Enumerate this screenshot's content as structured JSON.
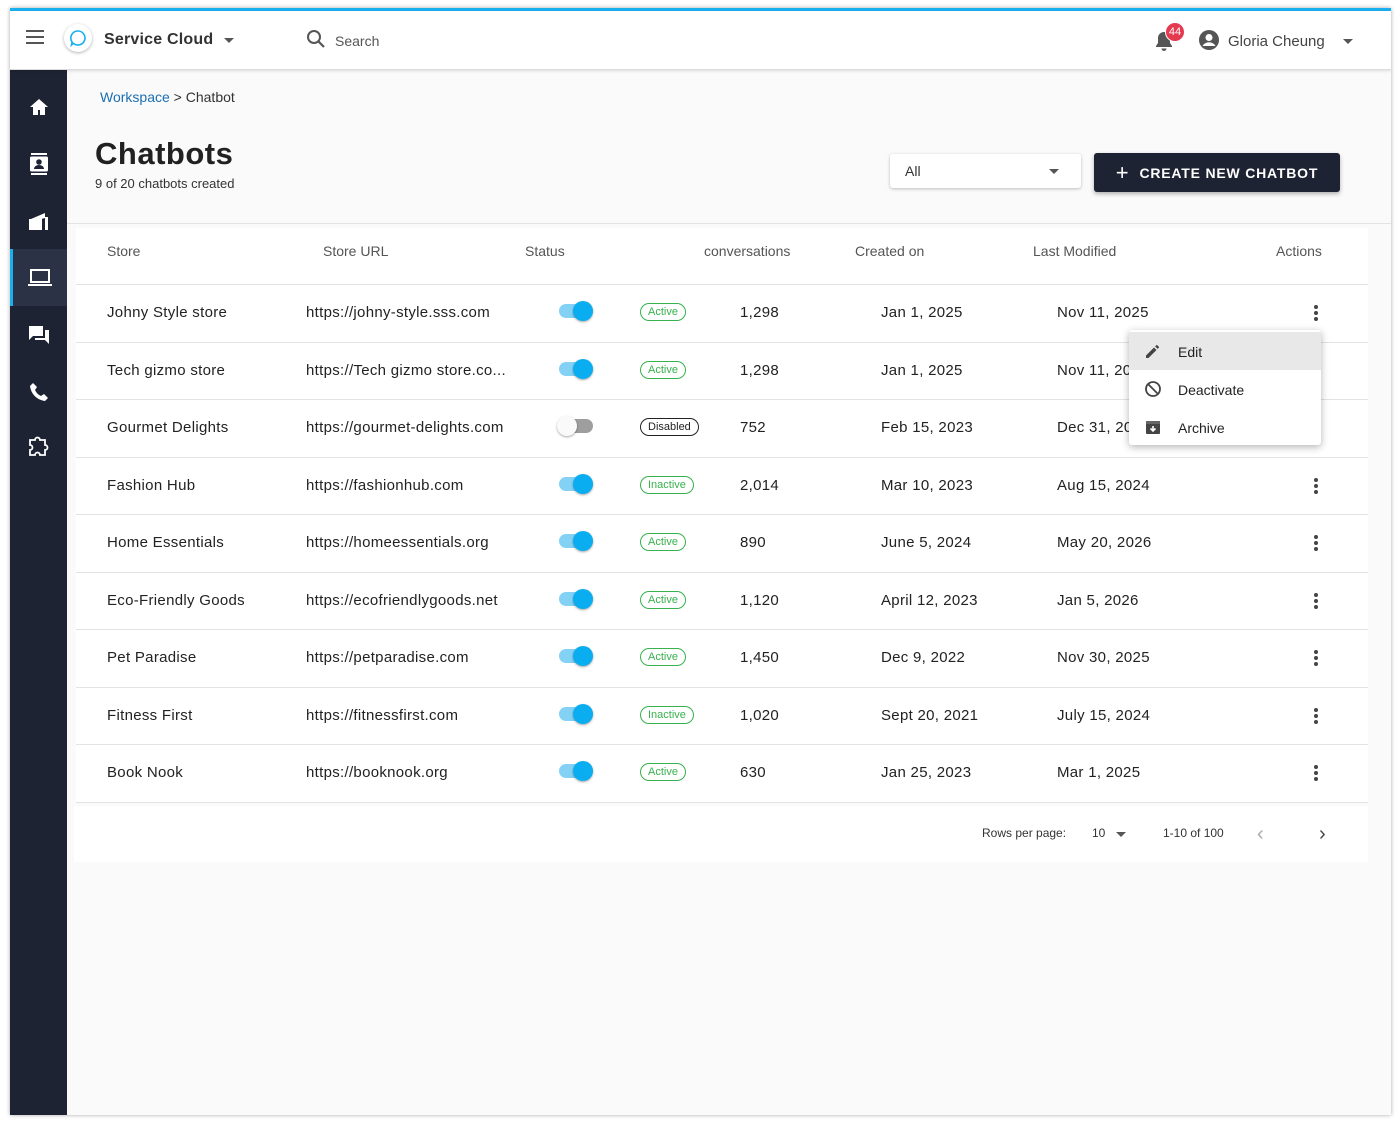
{
  "app": {
    "title": "Service Cloud",
    "search_label": "Search",
    "notification_count": "44",
    "user_name": "Gloria Cheung",
    "accent_color": "#1ab0ef"
  },
  "sidebar": {
    "items": [
      {
        "name": "home-icon"
      },
      {
        "name": "contacts-icon"
      },
      {
        "name": "campaign-icon"
      },
      {
        "name": "laptop-icon",
        "active": true
      },
      {
        "name": "chat-icon"
      },
      {
        "name": "phone-icon"
      },
      {
        "name": "puzzle-icon"
      }
    ]
  },
  "breadcrumb": {
    "link": "Workspace",
    "separator": " > ",
    "current": "Chatbot"
  },
  "header": {
    "title": "Chatbots",
    "subtitle": "9 of 20 chatbots created",
    "filter_value": "All",
    "create_label": "CREATE NEW CHATBOT"
  },
  "table": {
    "columns": [
      "Store",
      "Store URL",
      "Status",
      "conversations",
      "Created on",
      "Last Modified",
      "Actions"
    ],
    "rows": [
      {
        "store": "Johny Style store",
        "url": "https://johny-style.sss.com",
        "toggle": "on",
        "status": "Active",
        "conversations": "1,298",
        "created": "Jan 1, 2025",
        "modified": "Nov 11, 2025"
      },
      {
        "store": "Tech gizmo store",
        "url": "https://Tech gizmo store.co...",
        "toggle": "on",
        "status": "Active",
        "conversations": "1,298",
        "created": "Jan 1, 2025",
        "modified": "Nov 11, 20"
      },
      {
        "store": "Gourmet Delights",
        "url": "https://gourmet-delights.com",
        "toggle": "off",
        "status": "Disabled",
        "conversations": "752",
        "created": "Feb 15, 2023",
        "modified": "Dec 31, 20"
      },
      {
        "store": "Fashion Hub",
        "url": "https://fashionhub.com",
        "toggle": "on",
        "status": "Inactive",
        "conversations": "2,014",
        "created": "Mar 10, 2023",
        "modified": "Aug 15, 2024"
      },
      {
        "store": "Home Essentials",
        "url": "https://homeessentials.org",
        "toggle": "on",
        "status": "Active",
        "conversations": "890",
        "created": "June 5, 2024",
        "modified": "May 20, 2026"
      },
      {
        "store": "Eco-Friendly Goods",
        "url": "https://ecofriendlygoods.net",
        "toggle": "on",
        "status": "Active",
        "conversations": "1,120",
        "created": "April 12, 2023",
        "modified": "Jan 5, 2026"
      },
      {
        "store": "Pet Paradise",
        "url": "https://petparadise.com",
        "toggle": "on",
        "status": "Active",
        "conversations": "1,450",
        "created": "Dec 9, 2022",
        "modified": "Nov 30, 2025"
      },
      {
        "store": "Fitness First",
        "url": "https://fitnessfirst.com",
        "toggle": "on",
        "status": "Inactive",
        "conversations": "1,020",
        "created": "Sept 20, 2021",
        "modified": "July 15, 2024"
      },
      {
        "store": "Book Nook",
        "url": "https://booknook.org",
        "toggle": "on",
        "status": "Active",
        "conversations": "630",
        "created": "Jan 25, 2023",
        "modified": "Mar 1, 2025"
      }
    ]
  },
  "menu": {
    "items": [
      {
        "label": "Edit",
        "icon": "pencil-icon"
      },
      {
        "label": "Deactivate",
        "icon": "block-icon"
      },
      {
        "label": "Archive",
        "icon": "archive-icon"
      }
    ]
  },
  "pagination": {
    "rows_label": "Rows per page:",
    "rows_value": "10",
    "range": "1-10 of 100"
  }
}
